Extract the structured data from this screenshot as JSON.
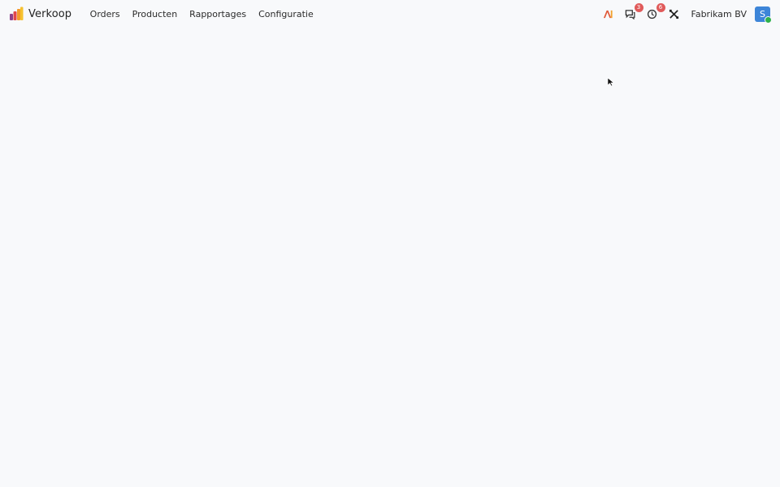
{
  "navbar": {
    "app_name": "Verkoop",
    "logo_icon": "sales-app-logo-icon",
    "menu": [
      {
        "label": "Orders"
      },
      {
        "label": "Producten"
      },
      {
        "label": "Rapportages"
      },
      {
        "label": "Configuratie"
      }
    ],
    "systray": {
      "debug_icon": "debug-icon",
      "messages": {
        "icon": "chat-icon",
        "count": "3"
      },
      "activities": {
        "icon": "clock-icon",
        "count": "6"
      },
      "tools_icon": "tools-icon",
      "company": "Fabrikam BV",
      "user_initial": "S"
    }
  },
  "colors": {
    "background": "#f8f9fb",
    "badge": "#e05a5a",
    "avatar": "#3d85d8",
    "presence": "#2eb14a"
  }
}
